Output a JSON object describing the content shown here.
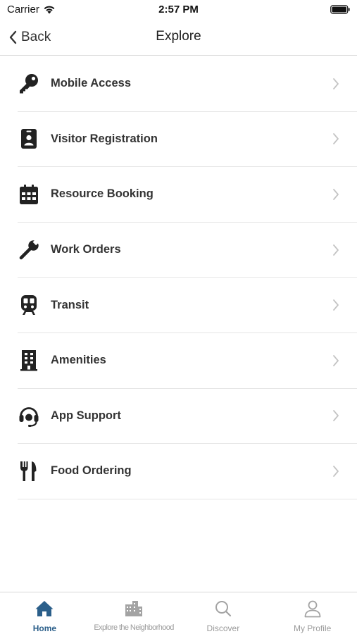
{
  "status_bar": {
    "carrier": "Carrier",
    "time": "2:57 PM"
  },
  "nav": {
    "back_label": "Back",
    "title": "Explore"
  },
  "menu": {
    "items": [
      {
        "label": "Mobile Access",
        "icon": "key-icon"
      },
      {
        "label": "Visitor Registration",
        "icon": "id-badge-icon"
      },
      {
        "label": "Resource Booking",
        "icon": "calendar-icon"
      },
      {
        "label": "Work Orders",
        "icon": "wrench-icon"
      },
      {
        "label": "Transit",
        "icon": "train-icon"
      },
      {
        "label": "Amenities",
        "icon": "building-icon"
      },
      {
        "label": "App Support",
        "icon": "headset-icon"
      },
      {
        "label": "Food Ordering",
        "icon": "utensils-icon"
      }
    ]
  },
  "tabs": {
    "items": [
      {
        "label": "Home",
        "icon": "home-icon",
        "active": true
      },
      {
        "label": "Explore the Neighborhood",
        "icon": "city-icon",
        "active": false
      },
      {
        "label": "Discover",
        "icon": "search-icon",
        "active": false
      },
      {
        "label": "My Profile",
        "icon": "person-icon",
        "active": false
      }
    ]
  },
  "colors": {
    "active_tab": "#2b5f8a",
    "inactive_tab": "#9a9a9a",
    "icon": "#222222",
    "chevron": "#c4c4c4"
  }
}
